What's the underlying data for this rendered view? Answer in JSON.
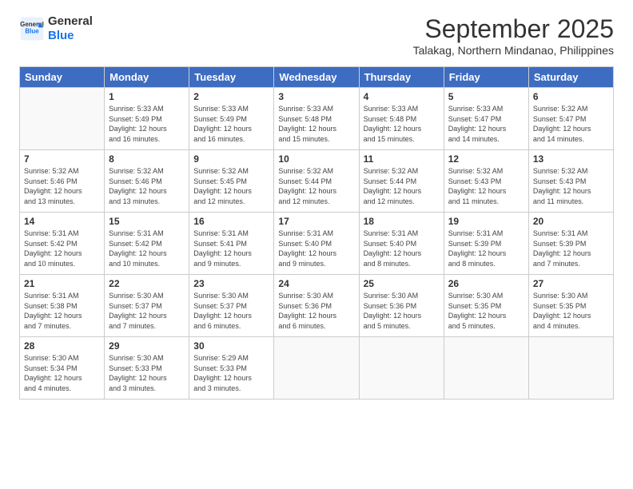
{
  "header": {
    "logo_line1": "General",
    "logo_line2": "Blue",
    "month": "September 2025",
    "location": "Talakag, Northern Mindanao, Philippines"
  },
  "days_of_week": [
    "Sunday",
    "Monday",
    "Tuesday",
    "Wednesday",
    "Thursday",
    "Friday",
    "Saturday"
  ],
  "weeks": [
    [
      {
        "day": "",
        "info": ""
      },
      {
        "day": "1",
        "info": "Sunrise: 5:33 AM\nSunset: 5:49 PM\nDaylight: 12 hours\nand 16 minutes."
      },
      {
        "day": "2",
        "info": "Sunrise: 5:33 AM\nSunset: 5:49 PM\nDaylight: 12 hours\nand 16 minutes."
      },
      {
        "day": "3",
        "info": "Sunrise: 5:33 AM\nSunset: 5:48 PM\nDaylight: 12 hours\nand 15 minutes."
      },
      {
        "day": "4",
        "info": "Sunrise: 5:33 AM\nSunset: 5:48 PM\nDaylight: 12 hours\nand 15 minutes."
      },
      {
        "day": "5",
        "info": "Sunrise: 5:33 AM\nSunset: 5:47 PM\nDaylight: 12 hours\nand 14 minutes."
      },
      {
        "day": "6",
        "info": "Sunrise: 5:32 AM\nSunset: 5:47 PM\nDaylight: 12 hours\nand 14 minutes."
      }
    ],
    [
      {
        "day": "7",
        "info": "Sunrise: 5:32 AM\nSunset: 5:46 PM\nDaylight: 12 hours\nand 13 minutes."
      },
      {
        "day": "8",
        "info": "Sunrise: 5:32 AM\nSunset: 5:46 PM\nDaylight: 12 hours\nand 13 minutes."
      },
      {
        "day": "9",
        "info": "Sunrise: 5:32 AM\nSunset: 5:45 PM\nDaylight: 12 hours\nand 12 minutes."
      },
      {
        "day": "10",
        "info": "Sunrise: 5:32 AM\nSunset: 5:44 PM\nDaylight: 12 hours\nand 12 minutes."
      },
      {
        "day": "11",
        "info": "Sunrise: 5:32 AM\nSunset: 5:44 PM\nDaylight: 12 hours\nand 12 minutes."
      },
      {
        "day": "12",
        "info": "Sunrise: 5:32 AM\nSunset: 5:43 PM\nDaylight: 12 hours\nand 11 minutes."
      },
      {
        "day": "13",
        "info": "Sunrise: 5:32 AM\nSunset: 5:43 PM\nDaylight: 12 hours\nand 11 minutes."
      }
    ],
    [
      {
        "day": "14",
        "info": "Sunrise: 5:31 AM\nSunset: 5:42 PM\nDaylight: 12 hours\nand 10 minutes."
      },
      {
        "day": "15",
        "info": "Sunrise: 5:31 AM\nSunset: 5:42 PM\nDaylight: 12 hours\nand 10 minutes."
      },
      {
        "day": "16",
        "info": "Sunrise: 5:31 AM\nSunset: 5:41 PM\nDaylight: 12 hours\nand 9 minutes."
      },
      {
        "day": "17",
        "info": "Sunrise: 5:31 AM\nSunset: 5:40 PM\nDaylight: 12 hours\nand 9 minutes."
      },
      {
        "day": "18",
        "info": "Sunrise: 5:31 AM\nSunset: 5:40 PM\nDaylight: 12 hours\nand 8 minutes."
      },
      {
        "day": "19",
        "info": "Sunrise: 5:31 AM\nSunset: 5:39 PM\nDaylight: 12 hours\nand 8 minutes."
      },
      {
        "day": "20",
        "info": "Sunrise: 5:31 AM\nSunset: 5:39 PM\nDaylight: 12 hours\nand 7 minutes."
      }
    ],
    [
      {
        "day": "21",
        "info": "Sunrise: 5:31 AM\nSunset: 5:38 PM\nDaylight: 12 hours\nand 7 minutes."
      },
      {
        "day": "22",
        "info": "Sunrise: 5:30 AM\nSunset: 5:37 PM\nDaylight: 12 hours\nand 7 minutes."
      },
      {
        "day": "23",
        "info": "Sunrise: 5:30 AM\nSunset: 5:37 PM\nDaylight: 12 hours\nand 6 minutes."
      },
      {
        "day": "24",
        "info": "Sunrise: 5:30 AM\nSunset: 5:36 PM\nDaylight: 12 hours\nand 6 minutes."
      },
      {
        "day": "25",
        "info": "Sunrise: 5:30 AM\nSunset: 5:36 PM\nDaylight: 12 hours\nand 5 minutes."
      },
      {
        "day": "26",
        "info": "Sunrise: 5:30 AM\nSunset: 5:35 PM\nDaylight: 12 hours\nand 5 minutes."
      },
      {
        "day": "27",
        "info": "Sunrise: 5:30 AM\nSunset: 5:35 PM\nDaylight: 12 hours\nand 4 minutes."
      }
    ],
    [
      {
        "day": "28",
        "info": "Sunrise: 5:30 AM\nSunset: 5:34 PM\nDaylight: 12 hours\nand 4 minutes."
      },
      {
        "day": "29",
        "info": "Sunrise: 5:30 AM\nSunset: 5:33 PM\nDaylight: 12 hours\nand 3 minutes."
      },
      {
        "day": "30",
        "info": "Sunrise: 5:29 AM\nSunset: 5:33 PM\nDaylight: 12 hours\nand 3 minutes."
      },
      {
        "day": "",
        "info": ""
      },
      {
        "day": "",
        "info": ""
      },
      {
        "day": "",
        "info": ""
      },
      {
        "day": "",
        "info": ""
      }
    ]
  ]
}
